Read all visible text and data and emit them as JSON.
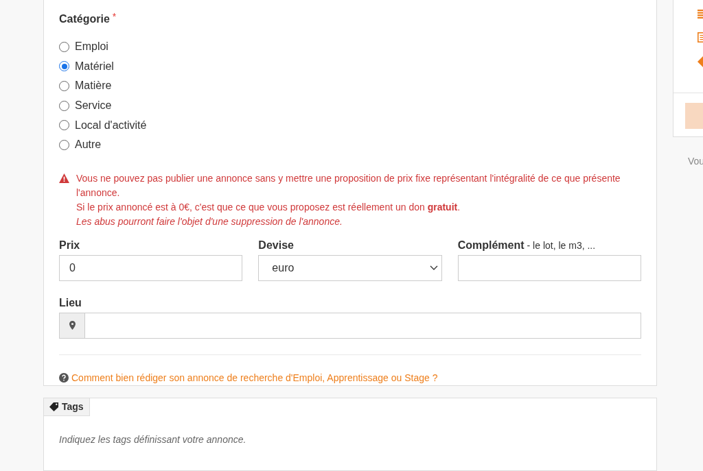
{
  "category": {
    "label": "Catégorie",
    "required_mark": "*",
    "options": [
      {
        "label": "Emploi",
        "selected": false
      },
      {
        "label": "Matériel",
        "selected": true
      },
      {
        "label": "Matière",
        "selected": false
      },
      {
        "label": "Service",
        "selected": false
      },
      {
        "label": "Local d'activité",
        "selected": false
      },
      {
        "label": "Autre",
        "selected": false
      }
    ]
  },
  "warning": {
    "lines": [
      {
        "text": "Vous ne pouvez pas publier une annonce sans y mettre une proposition de prix fixe représentant l'intégralité de ce que présente l'annonce.",
        "italic": false
      },
      {
        "text": "Si le prix annoncé est à 0€, c'est que ce que vous proposez est réellement un don **gratuit**.",
        "italic": false
      },
      {
        "text": "Les abus pourront faire l'objet d'une suppression de l'annonce.",
        "italic": true
      }
    ]
  },
  "fields": [
    {
      "kind": "text",
      "label": "Prix",
      "value": "0"
    },
    {
      "kind": "select",
      "label": "Devise",
      "value": "euro"
    },
    {
      "kind": "text",
      "label": "Complément",
      "hint": "- le lot, le m3, ..."
    }
  ],
  "location": {
    "label": "Lieu"
  },
  "help_link": "Comment bien rédiger son annonce de recherche d'Emploi, Apprentissage ou Stage ?",
  "tags": {
    "tab": "Tags",
    "hint": "Indiquez les tags définissant votre annonce."
  },
  "sidebar": {
    "text": "Vou"
  }
}
